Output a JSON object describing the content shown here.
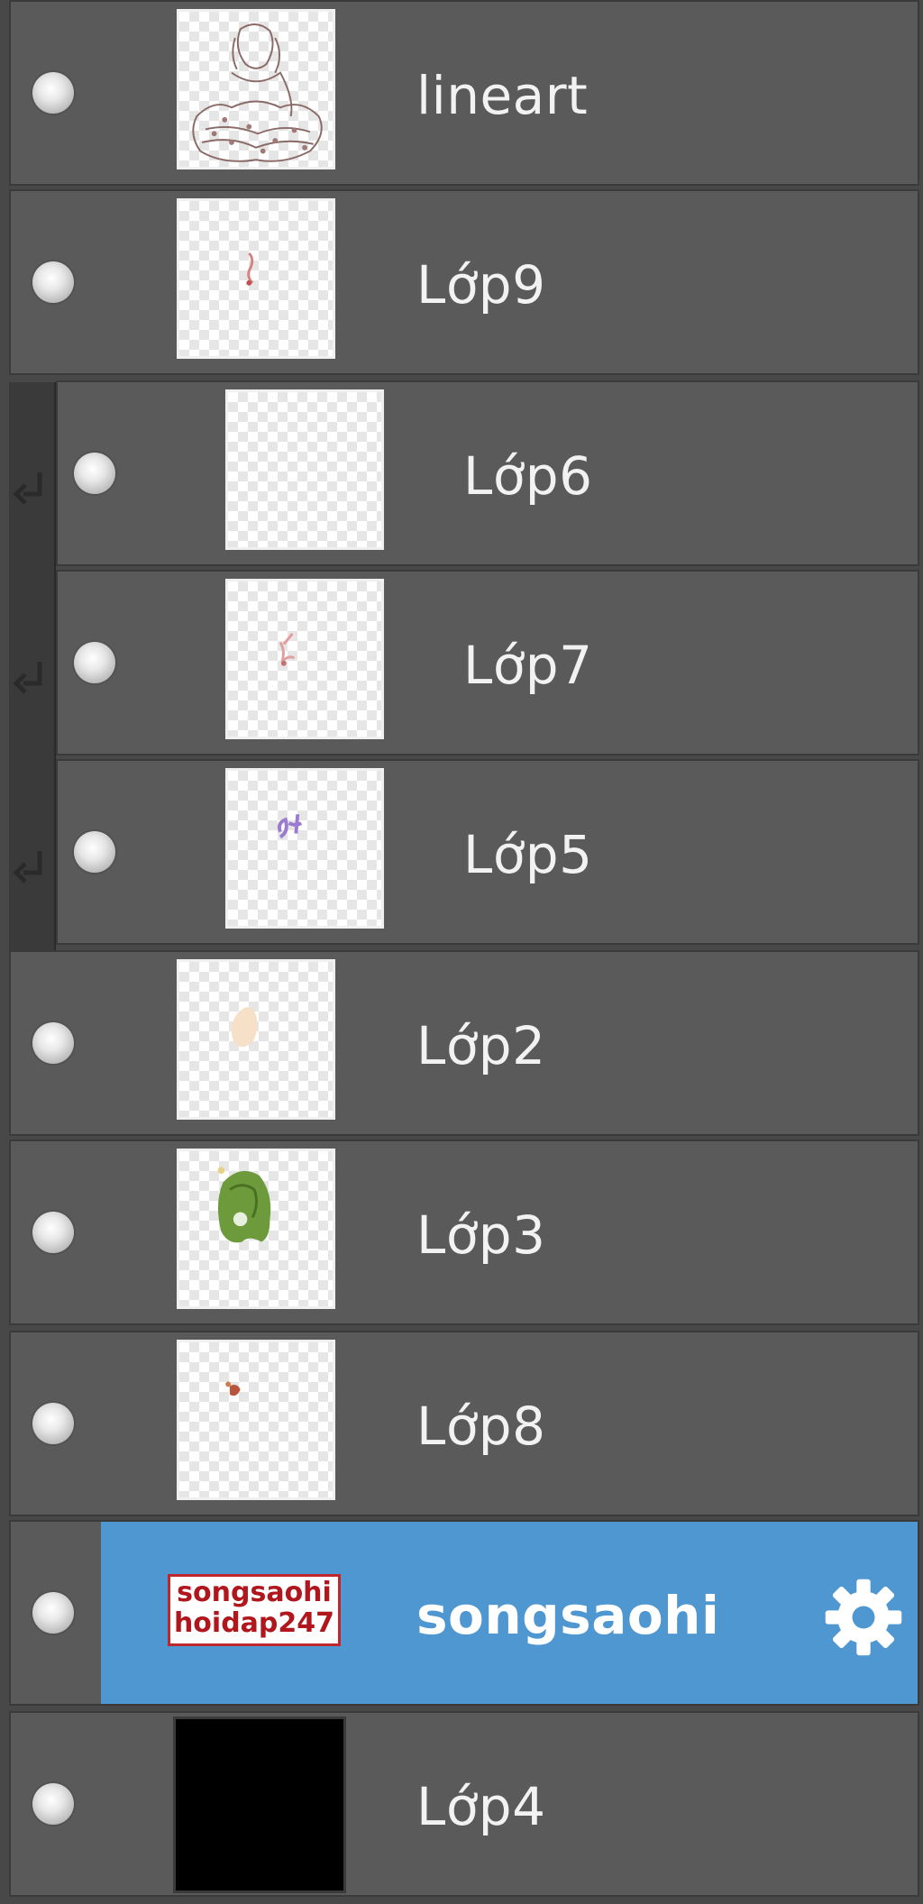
{
  "layers": [
    {
      "name": "lineart"
    },
    {
      "name": "Lớp9"
    },
    {
      "name": "Lớp6"
    },
    {
      "name": "Lớp7"
    },
    {
      "name": "Lớp5"
    },
    {
      "name": "Lớp2"
    },
    {
      "name": "Lớp3"
    },
    {
      "name": "Lớp8"
    },
    {
      "name": "songsaohi",
      "thumb_text": [
        "songsaohi",
        "hoidap247"
      ],
      "selected": true
    },
    {
      "name": "Lớp4"
    }
  ],
  "colors": {
    "row_bg": "#5a5a5a",
    "selected_bg": "#4f97d1",
    "border": "#3a3a3a",
    "text": "#f2f2f2"
  },
  "icons": {
    "visibility": "eye-dot-icon",
    "clipping": "clip-arrow-icon",
    "settings": "gear-icon"
  }
}
